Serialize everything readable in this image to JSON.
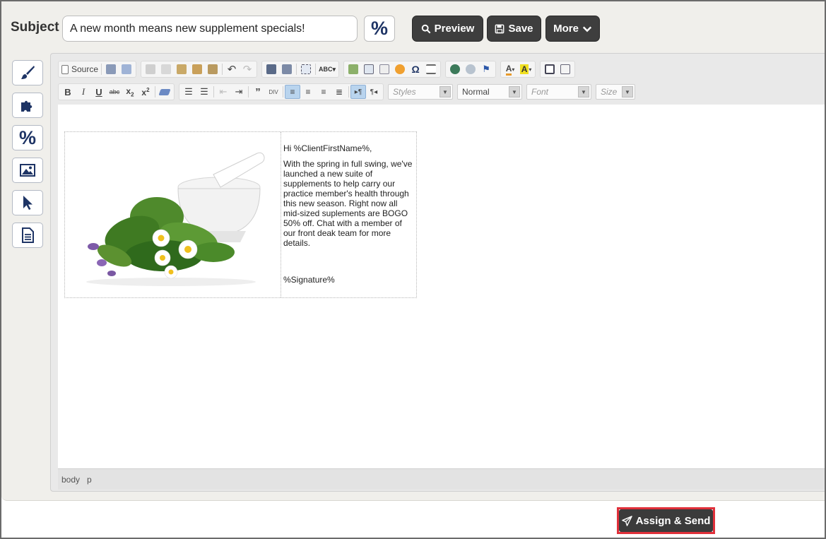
{
  "subject": {
    "label": "Subject",
    "value": "A new month means new supplement specials!",
    "merge_symbol": "%"
  },
  "actions": {
    "preview_label": "Preview",
    "save_label": "Save",
    "more_label": "More"
  },
  "side_tools": [
    {
      "name": "brush-icon"
    },
    {
      "name": "puzzle-icon"
    },
    {
      "name": "percent-icon",
      "symbol": "%"
    },
    {
      "name": "image-icon"
    },
    {
      "name": "cursor-icon"
    },
    {
      "name": "document-icon"
    }
  ],
  "toolbar": {
    "source_label": "Source",
    "styles_placeholder": "Styles",
    "format_value": "Normal",
    "font_placeholder": "Font",
    "size_placeholder": "Size"
  },
  "email": {
    "greeting": "Hi %ClientFirstName%,",
    "body": "With the spring in full swing, we've launched a new suite of supplements to help carry our practice member's health through this new season. Right now all mid-sized suplements are BOGO 50% off. Chat with a member of our front deak team for more details.",
    "signature": "%Signature%"
  },
  "statusbar": {
    "path": [
      "body",
      "p"
    ]
  },
  "footer": {
    "assign_label": "Assign & Send"
  },
  "colors": {
    "accent_navy": "#1e3465",
    "dark_button": "#3e3e3e",
    "highlight_red": "#e0303a"
  }
}
